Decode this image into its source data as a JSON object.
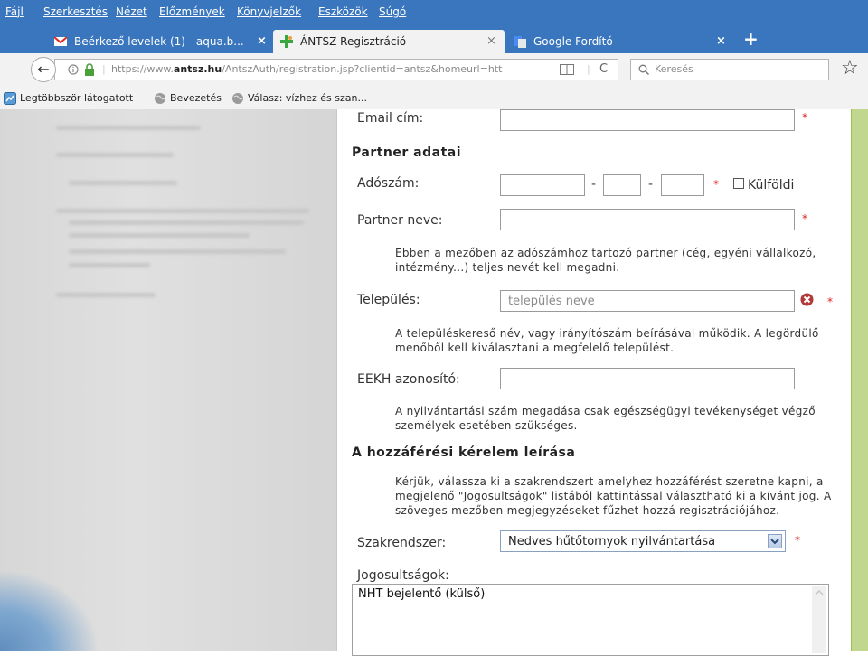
{
  "menu": [
    "Fájl",
    "Szerkesztés",
    "Nézet",
    "Előzmények",
    "Könyvjelzők",
    "Eszközök",
    "Súgó"
  ],
  "tabs": [
    {
      "title": "Beérkező levelek (1) - aqua.b...",
      "close": "×",
      "icon": "gmail-icon"
    },
    {
      "title": "ÁNTSZ Regisztráció",
      "close": "×",
      "icon": "antsz-icon"
    },
    {
      "title": "Google Fordító",
      "close": "×",
      "icon": "google-translate-icon"
    }
  ],
  "new_tab": "+",
  "toolbar": {
    "back": "←",
    "url_prefix": "https://www.",
    "url_domain": "antsz.hu",
    "url_rest": "/AntszAuth/registration.jsp?clientid=antsz&homeurl=htt",
    "reload": "C",
    "search_placeholder": "Keresés",
    "star": "☆"
  },
  "bookmarks": [
    "Legtöbbször látogatott",
    "Bevezetés",
    "Válasz: vízhez és szan..."
  ],
  "form": {
    "email_label": "Email cím:",
    "partner_header": "Partner adatai",
    "tax_label": "Adószám:",
    "foreign_label": "Külföldi",
    "partner_name_label": "Partner neve:",
    "partner_help": "Ebben a mezőben az adószámhoz tartozó partner (cég, egyéni vállalkozó, intézmény...) teljes nevét kell megadni.",
    "settlement_label": "Település:",
    "settlement_placeholder": "település neve",
    "settlement_help": "A településkereső név, vagy irányítószám beírásával működik. A legördülő menőből kell kiválasztani a megfelelő települést.",
    "eekh_label": "EEKH azonosító:",
    "eekh_help": "A nyilvántartási szám megadása csak egészségügyi tevékenységet végző személyek esetében szükséges.",
    "access_header": "A hozzáférési kérelem leírása",
    "access_help": "Kérjük, válassza ki a szakrendszert amelyhez hozzáférést szeretne kapni, a megjelenő \"Jogosultságok\" listából kattintással választható ki a kívánt jog. A szöveges mezőben megjegyzéseket fűzhet hozzá regisztrációjához.",
    "system_label": "Szakrendszer:",
    "system_value": "Nedves hűtőtornyok nyilvántartása",
    "rights_label": "Jogosultságok:",
    "rights_value": "NHT bejelentő (külső)",
    "required_mark": "*",
    "dash": "-"
  }
}
